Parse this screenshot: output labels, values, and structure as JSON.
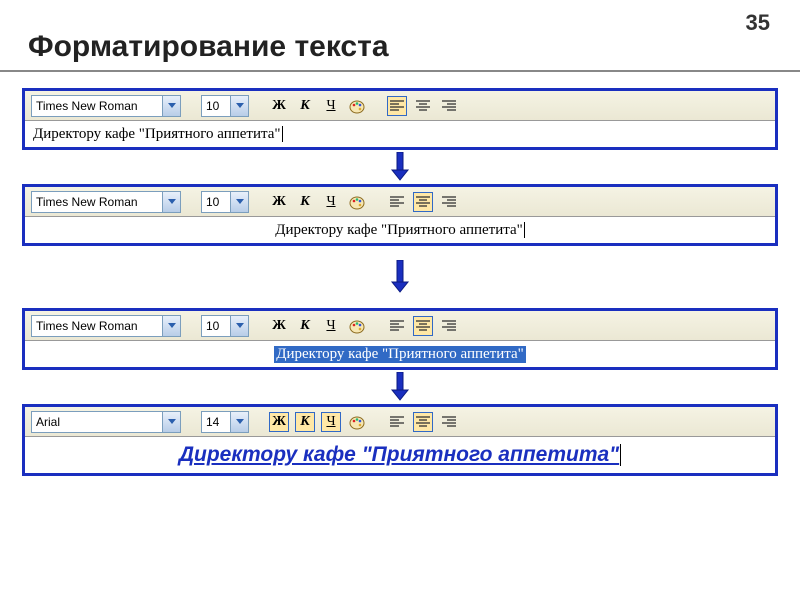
{
  "pageNumber": "35",
  "title": "Форматирование текста",
  "sampleText": "Директору кафе \"Приятного аппетита\"",
  "panels": [
    {
      "font": "Times New Roman",
      "size": "10",
      "bold": false,
      "italic": false,
      "underline": false,
      "align": "left",
      "textStyle": "plain-left",
      "selected": false
    },
    {
      "font": "Times New Roman",
      "size": "10",
      "bold": false,
      "italic": false,
      "underline": false,
      "align": "center",
      "textStyle": "plain-center",
      "selected": false
    },
    {
      "font": "Times New Roman",
      "size": "10",
      "bold": false,
      "italic": false,
      "underline": false,
      "align": "center",
      "textStyle": "plain-center",
      "selected": true
    },
    {
      "font": "Arial",
      "size": "14",
      "bold": true,
      "italic": true,
      "underline": true,
      "align": "center",
      "textStyle": "final",
      "selected": false
    }
  ],
  "labels": {
    "bold": "Ж",
    "italic": "К",
    "underline": "Ч"
  }
}
